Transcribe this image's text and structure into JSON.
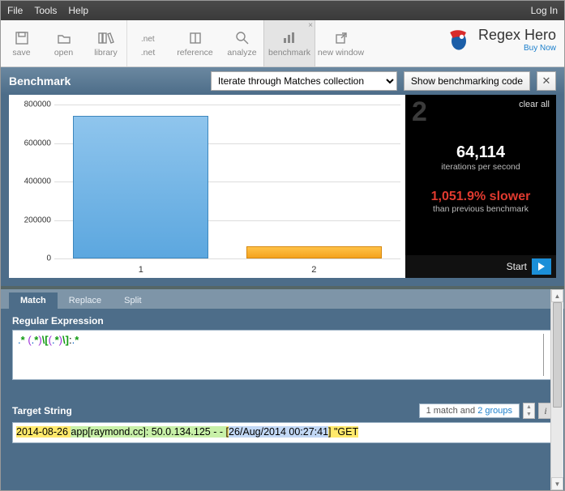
{
  "menu": {
    "file": "File",
    "tools": "Tools",
    "help": "Help",
    "login": "Log In"
  },
  "toolbar": {
    "save": "save",
    "open": "open",
    "library": "library",
    "net": ".net",
    "reference": "reference",
    "analyze": "analyze",
    "benchmark": "benchmark",
    "newwindow": "new window"
  },
  "brand": {
    "name": "Regex Hero",
    "buy": "Buy Now"
  },
  "benchbar": {
    "title": "Benchmark",
    "mode_selected": "Iterate through Matches collection",
    "codebtn": "Show benchmarking code"
  },
  "panel": {
    "run_index": "2",
    "clear": "clear all",
    "iterations": "64,114",
    "iterations_label": "iterations per second",
    "slower": "1,051.9% slower",
    "slower_label": "than previous benchmark",
    "start": "Start"
  },
  "chart_data": {
    "type": "bar",
    "categories": [
      "1",
      "2"
    ],
    "values": [
      740000,
      64114
    ],
    "ylim": [
      0,
      800000
    ],
    "yticks": [
      0,
      200000,
      400000,
      600000,
      800000
    ],
    "colors": [
      "#5ca7df",
      "#f4a21e"
    ]
  },
  "tabs": {
    "match": "Match",
    "replace": "Replace",
    "split": "Split"
  },
  "regex": {
    "label": "Regular Expression",
    "tokens": [
      {
        "t": ".",
        "c": "bl"
      },
      {
        "t": "*",
        "c": "gr"
      },
      {
        "t": " ",
        "c": ""
      },
      {
        "t": "(",
        "c": "pu"
      },
      {
        "t": ".",
        "c": "bl"
      },
      {
        "t": "*",
        "c": "gr"
      },
      {
        "t": ")",
        "c": "pu"
      },
      {
        "t": "\\[",
        "c": "gr"
      },
      {
        "t": "(",
        "c": "pu"
      },
      {
        "t": ".",
        "c": "bl"
      },
      {
        "t": "*",
        "c": "gr"
      },
      {
        "t": ")",
        "c": "pu"
      },
      {
        "t": "\\]",
        "c": "gr"
      },
      {
        "t": ":",
        "c": ""
      },
      {
        "t": ".",
        "c": "bl"
      },
      {
        "t": "*",
        "c": "gr"
      }
    ]
  },
  "target": {
    "label": "Target String",
    "matchinfo_prefix": "1 match and ",
    "matchinfo_link": "2 groups",
    "segments": [
      {
        "t": "2014-08-26 ",
        "c": "y"
      },
      {
        "t": "app[raymond.cc]: 50.0.134.125 - - ",
        "c": "g1"
      },
      {
        "t": "[",
        "c": "y"
      },
      {
        "t": "26/Aug/2014 00:27:41",
        "c": "g2"
      },
      {
        "t": "]",
        "c": "y"
      },
      {
        "t": " \"GET",
        "c": "y"
      }
    ]
  }
}
